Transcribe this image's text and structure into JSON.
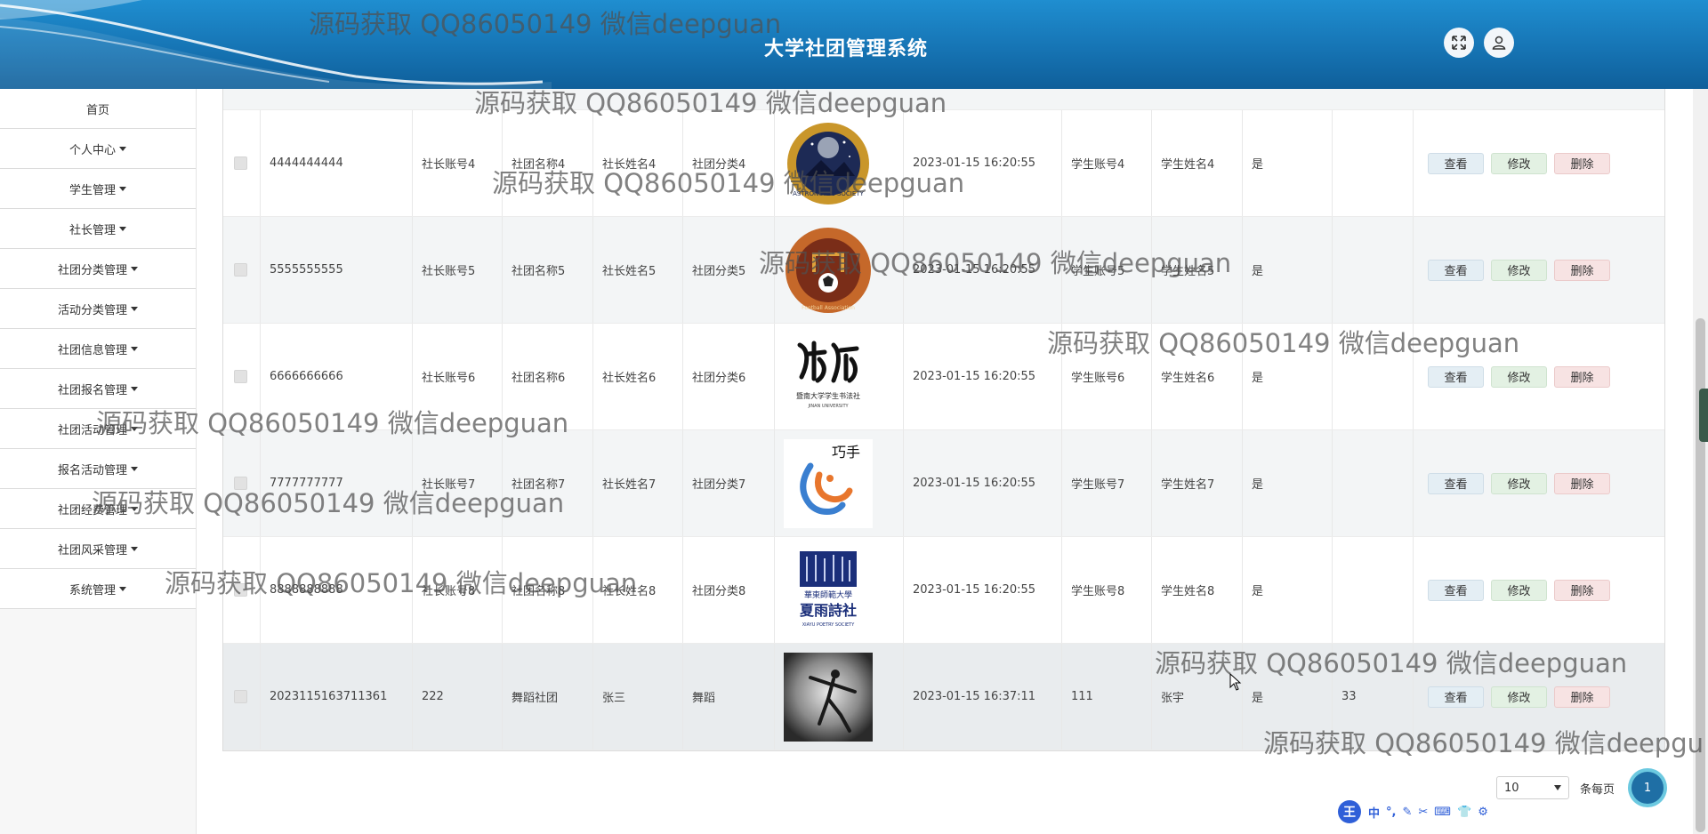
{
  "header": {
    "title": "大学社团管理系统",
    "fullscreen_icon": "expand-icon",
    "user_icon": "user-icon"
  },
  "sidebar": {
    "items": [
      {
        "label": "首页",
        "dropdown": false
      },
      {
        "label": "个人中心",
        "dropdown": true
      },
      {
        "label": "学生管理",
        "dropdown": true
      },
      {
        "label": "社长管理",
        "dropdown": true
      },
      {
        "label": "社团分类管理",
        "dropdown": true
      },
      {
        "label": "活动分类管理",
        "dropdown": true
      },
      {
        "label": "社团信息管理",
        "dropdown": true
      },
      {
        "label": "社团报名管理",
        "dropdown": true
      },
      {
        "label": "社团活动管理",
        "dropdown": true
      },
      {
        "label": "报名活动管理",
        "dropdown": true
      },
      {
        "label": "社团经费管理",
        "dropdown": true
      },
      {
        "label": "社团风采管理",
        "dropdown": true
      },
      {
        "label": "系统管理",
        "dropdown": true
      }
    ]
  },
  "table": {
    "actions": {
      "view": "查看",
      "edit": "修改",
      "delete": "删除"
    },
    "rows": [
      {
        "id": "4444444444",
        "leader_account": "社长账号4",
        "club_name": "社团名称4",
        "leader_name": "社长姓名4",
        "category": "社团分类4",
        "logo": "astronomy-society-logo",
        "time": "2023-01-15 16:20:55",
        "student_account": "学生账号4",
        "student_name": "学生姓名4",
        "approved": "是",
        "extra": ""
      },
      {
        "id": "5555555555",
        "leader_account": "社长账号5",
        "club_name": "社团名称5",
        "leader_name": "社长姓名5",
        "category": "社团分类5",
        "logo": "football-association-logo",
        "time": "2023-01-15 16:20:55",
        "student_account": "学生账号5",
        "student_name": "学生姓名5",
        "approved": "是",
        "extra": ""
      },
      {
        "id": "6666666666",
        "leader_account": "社长账号6",
        "club_name": "社团名称6",
        "leader_name": "社长姓名6",
        "category": "社团分类6",
        "logo": "calligraphy-society-logo",
        "time": "2023-01-15 16:20:55",
        "student_account": "学生账号6",
        "student_name": "学生姓名6",
        "approved": "是",
        "extra": ""
      },
      {
        "id": "7777777777",
        "leader_account": "社长账号7",
        "club_name": "社团名称7",
        "leader_name": "社长姓名7",
        "category": "社团分类7",
        "logo": "handcraft-club-logo",
        "time": "2023-01-15 16:20:55",
        "student_account": "学生账号7",
        "student_name": "学生姓名7",
        "approved": "是",
        "extra": ""
      },
      {
        "id": "8888888888",
        "leader_account": "社长账号8",
        "club_name": "社团名称8",
        "leader_name": "社长姓名8",
        "category": "社团分类8",
        "logo": "poetry-society-logo",
        "time": "2023-01-15 16:20:55",
        "student_account": "学生账号8",
        "student_name": "学生姓名8",
        "approved": "是",
        "extra": ""
      },
      {
        "id": "2023115163711361",
        "leader_account": "222",
        "club_name": "舞蹈社团",
        "leader_name": "张三",
        "category": "舞蹈",
        "logo": "dance-photo",
        "time": "2023-01-15 16:37:11",
        "student_account": "111",
        "student_name": "张宇",
        "approved": "是",
        "extra": "33"
      }
    ]
  },
  "logo_text": {
    "calligraphy_caption": "暨南大学学生书法社",
    "calligraphy_subcaption": "JINAN UNIVERSITY",
    "handcraft": "巧手",
    "poetry_top": "華東師範大學",
    "poetry_main": "夏雨詩社",
    "poetry_sub": "XIAYU POETRY SOCIETY",
    "astronomy_ring": "ASTRONOMIC SOCIETY",
    "football_ring": "Football Association"
  },
  "pagination": {
    "page_size": "10",
    "per_page_label": "条每页",
    "current_page": "1"
  },
  "ime_toolbar": {
    "logo": "王",
    "items": [
      "中",
      "°,",
      "✎",
      "✂",
      "⌨",
      "👕",
      "⚙"
    ]
  },
  "watermark": {
    "text": "源码获取 QQ86050149 微信deepguan",
    "text_cut": "源码获取 QQ86050149 微信deepgu"
  }
}
